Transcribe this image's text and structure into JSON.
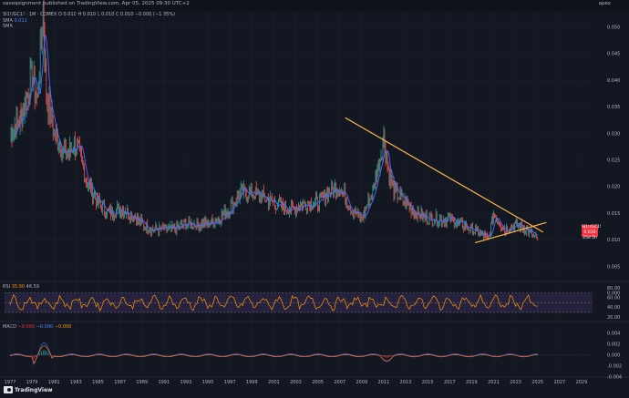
{
  "header": {
    "publisher_text": "saveqsignment published on TradingView.com, Apr 05, 2025 09:30 UTC+2",
    "top_right": "apex"
  },
  "main_chart": {
    "symbol_line": "SI1!/GC1! · 1M · COMEX   O 0.010  H 0.010  L 0.010  C 0.010  −0.000 (−1.35%)",
    "sma_label": "SMA",
    "sma_value": "0.011",
    "sma2_label": "SMA"
  },
  "rsi": {
    "label": "RSI",
    "v1": "35.00",
    "v2": "46.59"
  },
  "macd": {
    "label": "MACD",
    "v1": "−0.000",
    "v2": "−0.000",
    "v3": "−0.000"
  },
  "price_badge": {
    "line1": "SI1!/GC1!",
    "line2": "0.010",
    "line3": "25d 5h"
  },
  "colors": {
    "bg": "#131722",
    "up": "#26a69a",
    "down": "#ef5350",
    "sma_fast": "#4f6bff",
    "trendline": "#ffb74d",
    "rsi_band": "#7e57c2"
  },
  "chart_data": {
    "type": "line",
    "title": "",
    "ylim": [
      0.0,
      0.055
    ],
    "y_ticks": [
      "0.050",
      "0.045",
      "0.040",
      "0.035",
      "0.030",
      "0.025",
      "0.020",
      "0.015",
      "0.010",
      "0.005",
      "0.000"
    ],
    "x_ticks": [
      "1977",
      "1979",
      "1981",
      "1983",
      "1985",
      "1987",
      "1989",
      "1991",
      "1993",
      "1995",
      "1997",
      "1999",
      "2001",
      "2003",
      "2005",
      "2007",
      "2009",
      "2011",
      "2013",
      "2015",
      "2017",
      "2019",
      "2021",
      "2023",
      "2025",
      "2027",
      "2029"
    ],
    "series": [
      {
        "x": [
          1977,
          1978,
          1979,
          1979.5,
          1980,
          1980.3,
          1981,
          1982,
          1983,
          1984,
          1985,
          1986,
          1987,
          1988,
          1989,
          1990,
          1991,
          1992,
          1993,
          1994,
          1995,
          1996,
          1997,
          1998,
          1999,
          2000,
          2001,
          2002,
          2003,
          2004,
          2005,
          2006,
          2007,
          2008,
          2009,
          2010,
          2011,
          2011.5,
          2012,
          2013,
          2014,
          2015,
          2016,
          2017,
          2018,
          2019,
          2020,
          2020.5,
          2021,
          2022,
          2023,
          2024,
          2025
        ],
        "values": [
          0.03,
          0.033,
          0.041,
          0.036,
          0.054,
          0.038,
          0.03,
          0.026,
          0.028,
          0.021,
          0.017,
          0.015,
          0.016,
          0.015,
          0.013,
          0.012,
          0.012,
          0.012,
          0.013,
          0.013,
          0.013,
          0.014,
          0.016,
          0.019,
          0.019,
          0.018,
          0.017,
          0.016,
          0.016,
          0.017,
          0.017,
          0.019,
          0.02,
          0.016,
          0.014,
          0.019,
          0.029,
          0.022,
          0.019,
          0.017,
          0.015,
          0.014,
          0.014,
          0.014,
          0.013,
          0.012,
          0.011,
          0.01,
          0.015,
          0.012,
          0.013,
          0.012,
          0.01
        ]
      }
    ],
    "trendline_upper": {
      "x": [
        2007.5,
        2025.5
      ],
      "values": [
        0.033,
        0.0115
      ]
    },
    "trendline_lower": {
      "x": [
        2019.3,
        2025.8
      ],
      "values": [
        0.0095,
        0.0133
      ]
    },
    "rsi_levels": [
      70,
      50,
      30
    ]
  }
}
